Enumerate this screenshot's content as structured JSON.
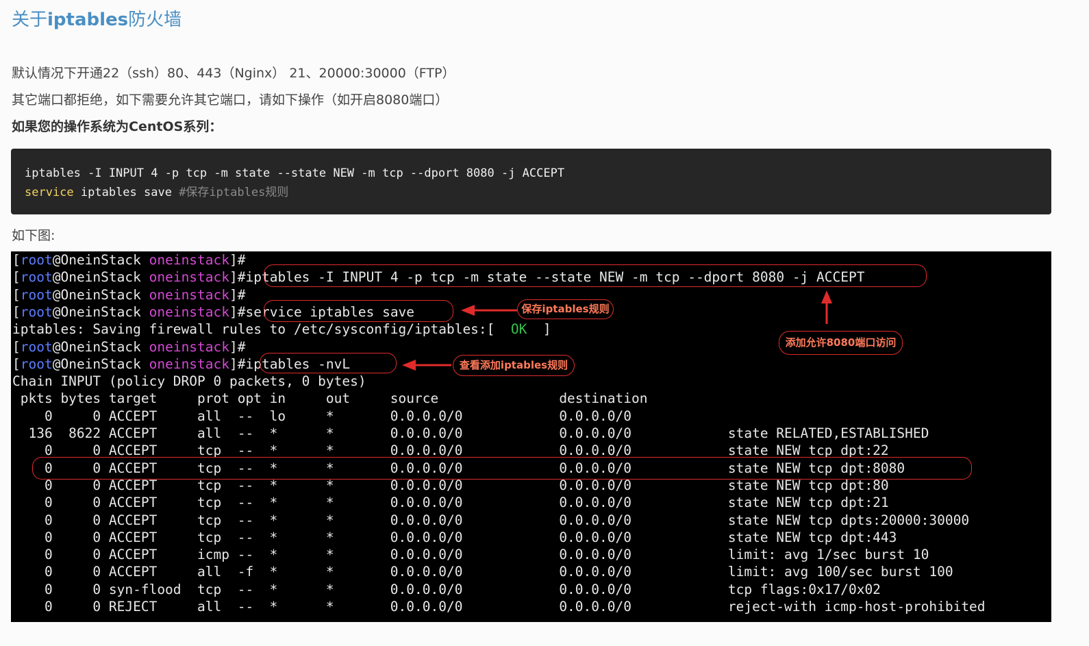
{
  "header": {
    "title_prefix": "关于",
    "title_en": "iptables",
    "title_suffix": "防火墙"
  },
  "paragraphs": [
    "默认情况下开通22（ssh）80、443（Nginx） 21、20000:30000（FTP）",
    "其它端口都拒绝，如下需要允许其它端口，请如下操作（如开启8080端口）",
    "如果您的操作系统为CentOS系列："
  ],
  "code": {
    "line1": "iptables -I INPUT 4 -p tcp -m state --state NEW -m tcp --dport 8080 -j ACCEPT",
    "line2_keyword": "service",
    "line2_rest": " iptables save ",
    "line2_comment": "#保存iptables规则"
  },
  "caption": "如下图:",
  "terminal": {
    "prompt": {
      "open": "[",
      "user": "root",
      "at_host": "@OneinStack ",
      "dir": "oneinstack",
      "close": "]#"
    },
    "cmd_add": "iptables -I INPUT 4 -p tcp -m state --state NEW -m tcp --dport 8080 -j ACCEPT",
    "cmd_save": "service iptables save",
    "save_output_pre": "iptables: Saving firewall rules to /etc/sysconfig/iptables:[  ",
    "save_output_ok": "OK",
    "save_output_post": "  ]",
    "cmd_list": "iptables -nvL",
    "chain_header": "Chain INPUT (policy DROP 0 packets, 0 bytes)",
    "columns": " pkts bytes target     prot opt in     out     source               destination",
    "rows": [
      "    0     0 ACCEPT     all  --  lo     *       0.0.0.0/0            0.0.0.0/0",
      "  136  8622 ACCEPT     all  --  *      *       0.0.0.0/0            0.0.0.0/0            state RELATED,ESTABLISHED",
      "    0     0 ACCEPT     tcp  --  *      *       0.0.0.0/0            0.0.0.0/0            state NEW tcp dpt:22",
      "    0     0 ACCEPT     tcp  --  *      *       0.0.0.0/0            0.0.0.0/0            state NEW tcp dpt:8080",
      "    0     0 ACCEPT     tcp  --  *      *       0.0.0.0/0            0.0.0.0/0            state NEW tcp dpt:80",
      "    0     0 ACCEPT     tcp  --  *      *       0.0.0.0/0            0.0.0.0/0            state NEW tcp dpt:21",
      "    0     0 ACCEPT     tcp  --  *      *       0.0.0.0/0            0.0.0.0/0            state NEW tcp dpts:20000:30000",
      "    0     0 ACCEPT     tcp  --  *      *       0.0.0.0/0            0.0.0.0/0            state NEW tcp dpt:443",
      "    0     0 ACCEPT     icmp --  *      *       0.0.0.0/0            0.0.0.0/0            limit: avg 1/sec burst 10",
      "    0     0 ACCEPT     all  -f  *      *       0.0.0.0/0            0.0.0.0/0            limit: avg 100/sec burst 100",
      "    0     0 syn-flood  tcp  --  *      *       0.0.0.0/0            0.0.0.0/0            tcp flags:0x17/0x02",
      "    0     0 REJECT     all  --  *      *       0.0.0.0/0            0.0.0.0/0            reject-with icmp-host-prohibited"
    ]
  },
  "annotations": {
    "save_rule": "保存iptables规则",
    "allow_8080": "添加允许8080端口访问",
    "view_rules": "查看添加iptables规则"
  },
  "colors": {
    "title": "#4a8fc4",
    "annotation_border": "#e12b2b",
    "annotation_text": "#ff7a5a",
    "prompt_user": "#5b7dff",
    "prompt_dir": "#d548d5",
    "ok": "#35c24a"
  }
}
